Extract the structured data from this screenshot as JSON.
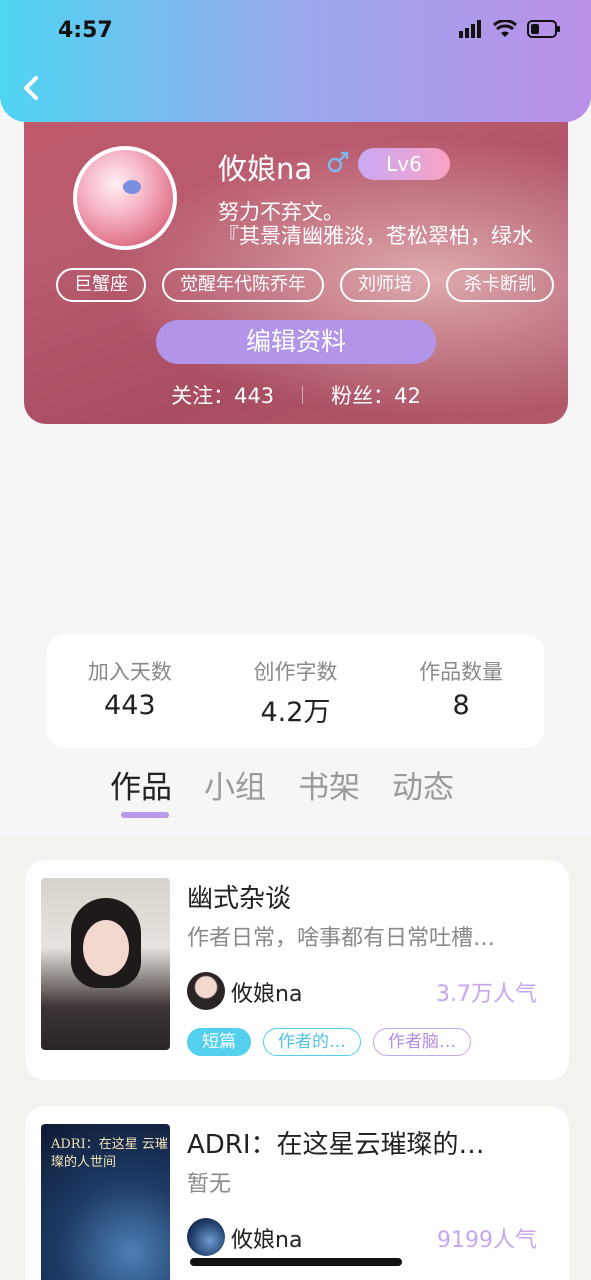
{
  "status_bar": {
    "time": "4:57"
  },
  "profile": {
    "nickname": "攸娘na",
    "level": "Lv6",
    "bio_line1": "努力不弃文。",
    "bio_line2": "『其景清幽雅淡，苍松翠柏，绿水",
    "tags": [
      "巨蟹座",
      "觉醒年代陈乔年",
      "刘师培",
      "杀卡断凯"
    ],
    "edit_label": "编辑资料",
    "following_label": "关注：443",
    "followers_label": "粉丝：42"
  },
  "stats": [
    {
      "label": "加入天数",
      "value": "443"
    },
    {
      "label": "创作字数",
      "value": "4.2万"
    },
    {
      "label": "作品数量",
      "value": "8"
    }
  ],
  "tabs": [
    "作品",
    "小组",
    "书架",
    "动态"
  ],
  "works": [
    {
      "title": "幽式杂谈",
      "desc": "作者日常，啥事都有日常吐槽…",
      "author": "攸娘na",
      "popularity": "3.7万人气",
      "tags": [
        "短篇",
        "作者的…",
        "作者脑…"
      ]
    },
    {
      "title": "ADRI：在这星云璀璨的…",
      "desc": "暂无",
      "author": "攸娘na",
      "popularity": "9199人气",
      "cover_text": "ADRI：在这星 云璀璨的人世间"
    }
  ],
  "colors": {
    "accent": "#b99ae8",
    "cyan": "#52d0ee",
    "purple": "#c6a6ee"
  },
  "icons": [
    "back-icon",
    "signal-icon",
    "wifi-icon",
    "battery-icon",
    "male-icon"
  ]
}
